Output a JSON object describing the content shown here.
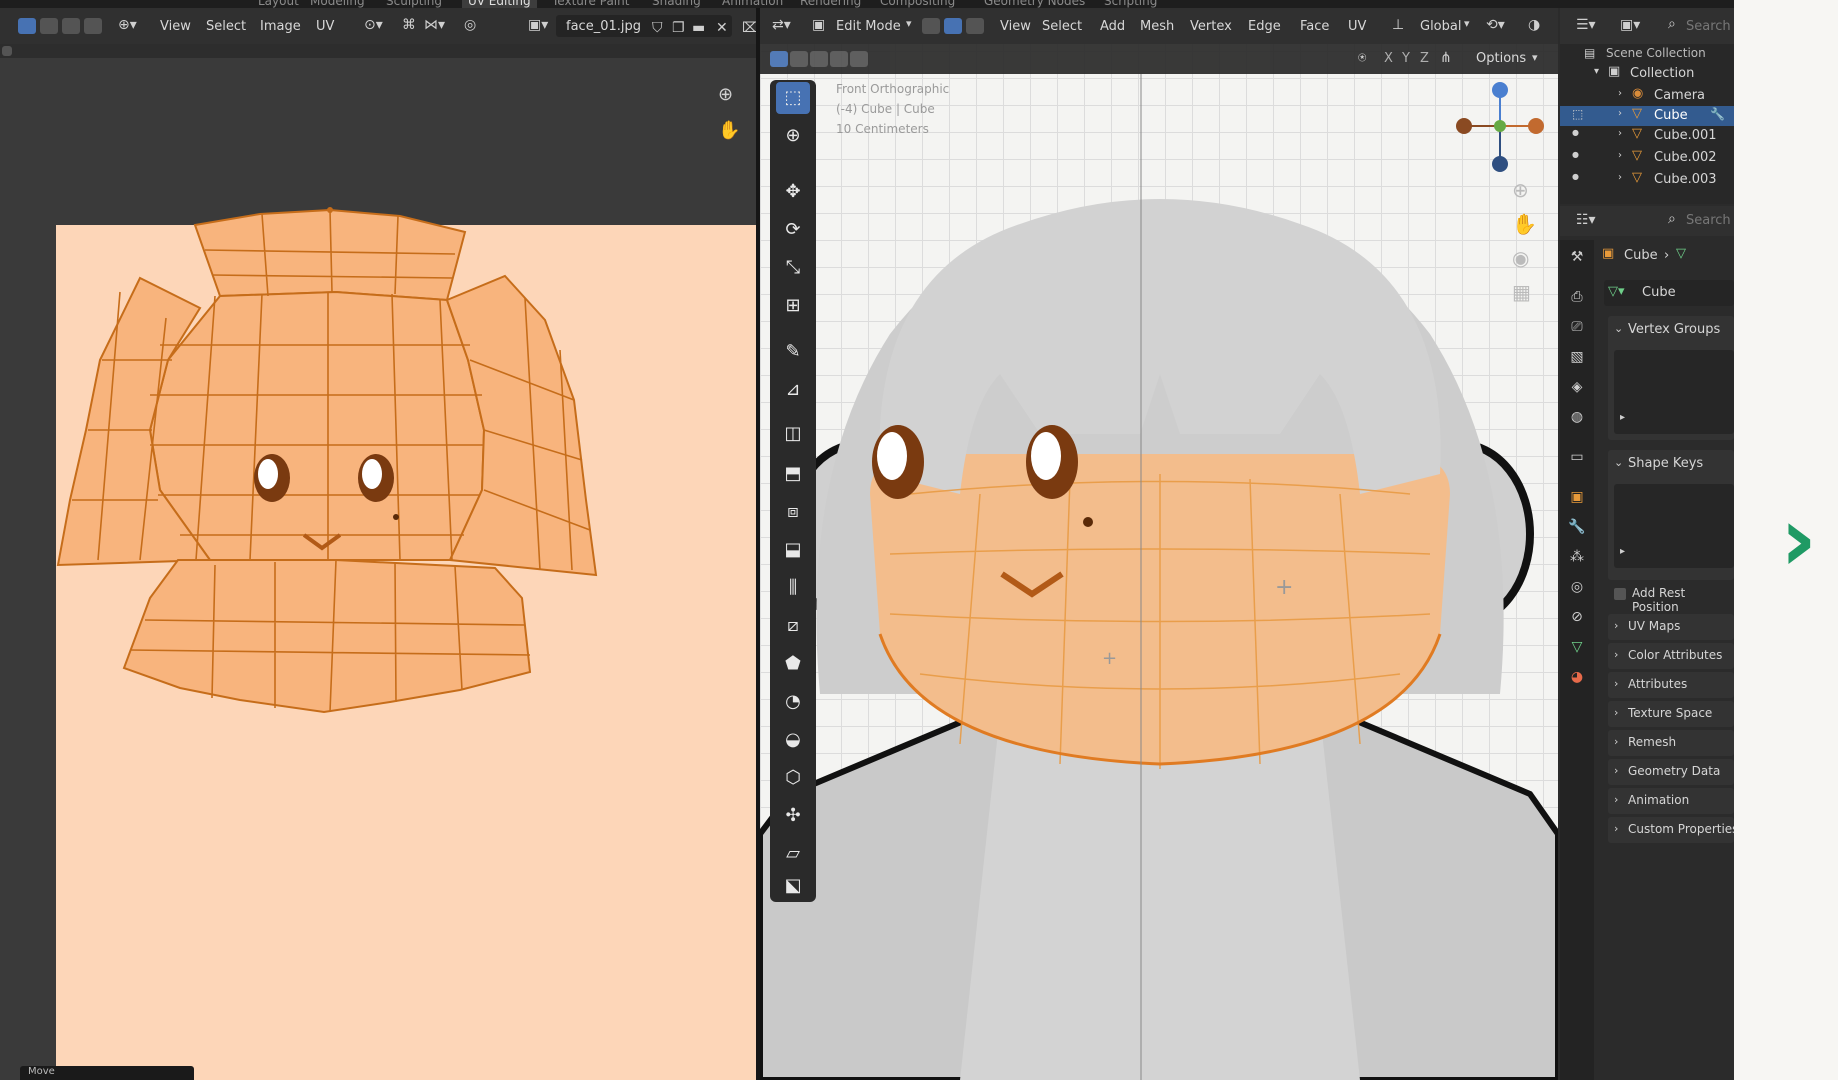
{
  "workspace_tabs": [
    "Layout",
    "Modeling",
    "Sculpting",
    "UV Editing",
    "Texture Paint",
    "Shading",
    "Animation",
    "Rendering",
    "Compositing",
    "Geometry Nodes",
    "Scripting"
  ],
  "uv_header": {
    "view": "View",
    "select": "Select",
    "image": "Image",
    "uv": "UV",
    "image_name": "face_01.jpg"
  },
  "viewport_header": {
    "mode": "Edit Mode",
    "view": "View",
    "select": "Select",
    "add": "Add",
    "mesh": "Mesh",
    "vertex": "Vertex",
    "edge": "Edge",
    "face": "Face",
    "uv": "UV",
    "orientation": "Global",
    "options": "Options",
    "x": "X",
    "y": "Y",
    "z": "Z"
  },
  "viewport_overlay": {
    "line1": "Front Orthographic",
    "line2": "(-4) Cube | Cube",
    "line3": "10 Centimeters"
  },
  "outliner": {
    "scene_collection": "Scene Collection",
    "collection": "Collection",
    "items": [
      "Camera",
      "Cube",
      "Cube.001",
      "Cube.002",
      "Cube.003"
    ],
    "search": "Search"
  },
  "properties": {
    "search": "Search",
    "breadcrumb_object": "Cube",
    "mesh_name": "Cube",
    "vertex_groups": "Vertex Groups",
    "shape_keys": "Shape Keys",
    "add_rest_position": "Add Rest Position",
    "sections": [
      "UV Maps",
      "Color Attributes",
      "Attributes",
      "Texture Space",
      "Remesh",
      "Geometry Data",
      "Animation",
      "Custom Properties"
    ]
  },
  "status": {
    "label": "Move"
  },
  "colors": {
    "accent": "#4772b3",
    "uv_fill": "#fdd6b8",
    "edge_orange": "#d9802a",
    "next_arrow": "#1f9a64"
  }
}
